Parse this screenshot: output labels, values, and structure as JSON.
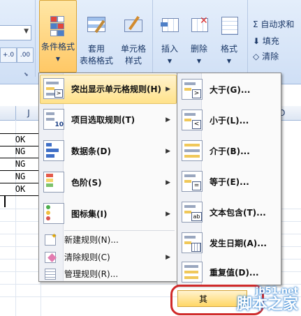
{
  "ribbon": {
    "buttons": {
      "conditional_format": "条件格式",
      "table_format": [
        "套用",
        "表格格式"
      ],
      "cell_style": [
        "单元格",
        "样式"
      ],
      "insert": "插入",
      "delete": "删除",
      "format": "格式"
    },
    "number_format_buttons": [
      "+.0",
      ".00"
    ],
    "right_group": [
      "Σ 自动求和",
      "填充",
      "清除"
    ]
  },
  "sheet": {
    "column_header": "J",
    "column_header_right": "O",
    "cells": [
      "OK",
      "NG",
      "NG",
      "NG",
      "OK"
    ]
  },
  "menu": {
    "items": [
      {
        "label": "突出显示单元格规则(H)",
        "has_submenu": true
      },
      {
        "label": "项目选取规则(T)",
        "has_submenu": true
      },
      {
        "label": "数据条(D)",
        "has_submenu": true
      },
      {
        "label": "色阶(S)",
        "has_submenu": true
      },
      {
        "label": "图标集(I)",
        "has_submenu": true
      }
    ],
    "small_items": [
      {
        "label": "新建规则(N)...",
        "has_submenu": false
      },
      {
        "label": "清除规则(C)",
        "has_submenu": true
      },
      {
        "label": "管理规则(R)...",
        "has_submenu": false
      }
    ]
  },
  "submenu": {
    "items": [
      {
        "label": "大于(G)..."
      },
      {
        "label": "小于(L)..."
      },
      {
        "label": "介于(B)..."
      },
      {
        "label": "等于(E)..."
      },
      {
        "label": "文本包含(T)..."
      },
      {
        "label": "发生日期(A)..."
      },
      {
        "label": "重复值(D)..."
      }
    ]
  },
  "bottom_button": "其",
  "watermark": {
    "line1": "jb51.net",
    "line2": "脚本之家"
  },
  "colors": {
    "highlight": "#ffe28a",
    "red_outline": "#d02a2a",
    "ribbon_bg": "#d6e4f7"
  }
}
